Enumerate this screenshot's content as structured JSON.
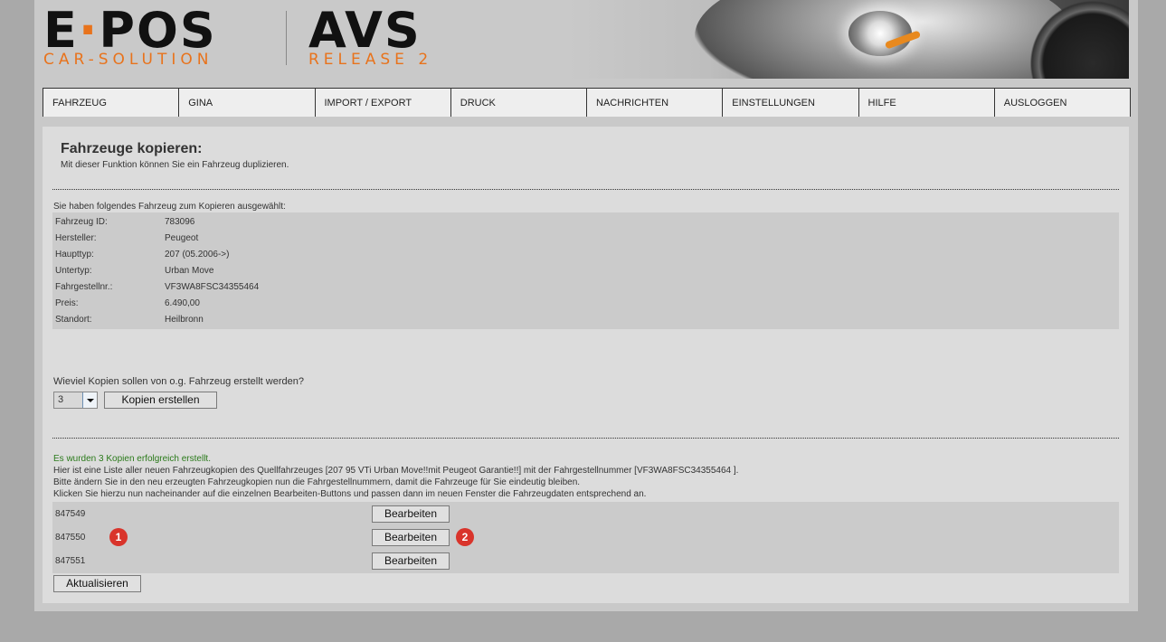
{
  "header": {
    "logo_main": "E",
    "logo_dot": "·",
    "logo_main2": "POS",
    "logo_sub": "CAR-SOLUTION",
    "product": "AVS",
    "release": "RELEASE 2"
  },
  "nav": {
    "items": [
      {
        "label": "FAHRZEUG"
      },
      {
        "label": "GINA"
      },
      {
        "label": "IMPORT / EXPORT"
      },
      {
        "label": "DRUCK"
      },
      {
        "label": "NACHRICHTEN"
      },
      {
        "label": "EINSTELLUNGEN"
      },
      {
        "label": "HILFE"
      },
      {
        "label": "AUSLOGGEN"
      }
    ]
  },
  "page": {
    "title": "Fahrzeuge kopieren:",
    "subtitle": "Mit dieser Funktion können Sie ein Fahrzeug duplizieren."
  },
  "selection": {
    "intro": "Sie haben folgendes Fahrzeug zum Kopieren ausgewählt:",
    "rows": [
      {
        "label": "Fahrzeug ID:",
        "value": "783096"
      },
      {
        "label": "Hersteller:",
        "value": "Peugeot"
      },
      {
        "label": "Haupttyp:",
        "value": "207 (05.2006->)"
      },
      {
        "label": "Untertyp:",
        "value": "Urban Move"
      },
      {
        "label": "Fahrgestellnr.:",
        "value": "VF3WA8FSC34355464"
      },
      {
        "label": "Preis:",
        "value": "6.490,00"
      },
      {
        "label": "Standort:",
        "value": "Heilbronn"
      }
    ]
  },
  "copy_form": {
    "question": "Wieviel Kopien sollen von o.g. Fahrzeug erstellt werden?",
    "count_value": "3",
    "create_button": "Kopien erstellen"
  },
  "result": {
    "success": "Es wurden 3 Kopien erfolgreich erstellt.",
    "line1": "Hier ist eine Liste aller neuen Fahrzeugkopien des Quellfahrzeuges [207 95 VTi Urban Move!!mit Peugeot Garantie!!] mit der Fahrgestellnummer [VF3WA8FSC34355464 ].",
    "line2": "Bitte ändern Sie in den neu erzeugten Fahrzeugkopien nun die Fahrgestellnummern, damit die Fahrzeuge für Sie eindeutig bleiben.",
    "line3": "Klicken Sie hierzu nun nacheinander auf die einzelnen Bearbeiten-Buttons und passen dann im neuen Fenster die Fahrzeugdaten entsprechend an.",
    "copies": [
      {
        "id": "847549",
        "button": "Bearbeiten"
      },
      {
        "id": "847550",
        "button": "Bearbeiten"
      },
      {
        "id": "847551",
        "button": "Bearbeiten"
      }
    ],
    "refresh_button": "Aktualisieren"
  },
  "annotations": {
    "badge1": "1",
    "badge2": "2",
    "badge_color": "#d9342b"
  }
}
